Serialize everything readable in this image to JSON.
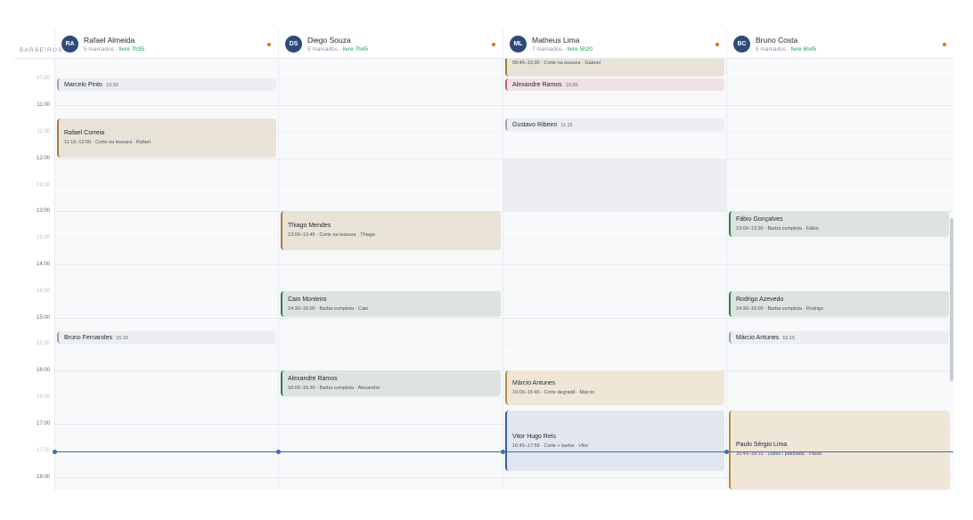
{
  "header": {
    "gutter_label": "BARBEIROS",
    "barbers": [
      {
        "initials": "RA",
        "name": "Rafael Almeida",
        "booked": "5 marcados",
        "sep": "·",
        "free": "livre 7h35"
      },
      {
        "initials": "DS",
        "name": "Diego Souza",
        "booked": "5 marcados",
        "sep": "·",
        "free": "livre 7h45"
      },
      {
        "initials": "ML",
        "name": "Matheus Lima",
        "booked": "7 marcados",
        "sep": "·",
        "free": "livre 5h20"
      },
      {
        "initials": "BC",
        "name": "Bruno Costa",
        "booked": "5 marcados",
        "sep": "·",
        "free": "livre 6h45"
      }
    ],
    "accent_dot_color": "#c77a23",
    "avatar_color": "#2f4a77"
  },
  "times": {
    "t1030": "10:30",
    "t1100": "11:00",
    "t1130": "11:30",
    "t1200": "12:00",
    "t1230": "12:30",
    "t1300": "13:00",
    "t1330": "13:30",
    "t1400": "14:00",
    "t1430": "14:30",
    "t1500": "15:00",
    "t1530": "15:30",
    "t1600": "16:00",
    "t1630": "16:30",
    "t1700": "17:00",
    "t1730": "17:30",
    "t1800": "18:00"
  },
  "events": {
    "ra_marcelo": {
      "title": "Marcelo Pinto",
      "time": "10:30"
    },
    "ra_rafael": {
      "title": "Rafael Correia",
      "detail": "11:15–12:00 · Corte na tesoura · Rafael"
    },
    "ra_bruno": {
      "title": "Bruno Fernandes",
      "time": "15:15"
    },
    "ds_thiago": {
      "title": "Thiago Mendes",
      "detail": "13:00–13:45 · Corte na tesoura · Thiago"
    },
    "ds_caio": {
      "title": "Caio Monteiro",
      "detail": "14:30–15:00 · Barba completa · Caio"
    },
    "ds_alexandre": {
      "title": "Alexandre Ramos",
      "detail": "16:00–16:30 · Barba completa · Alexandre"
    },
    "ml_gabriel": {
      "detail": "09:45–10:30 · Corte na tesoura · Gabriel"
    },
    "ml_alexandre": {
      "title": "Alexandre Ramos",
      "time": "10:30"
    },
    "ml_gustavo": {
      "title": "Gustavo Ribeiro",
      "time": "11:15"
    },
    "ml_marcio": {
      "title": "Márcio Antunes",
      "detail": "16:00–16:40 · Corte degradê · Márcio"
    },
    "ml_vitor": {
      "title": "Vitor Hugo Reis",
      "detail": "16:45–17:55 · Corte + barba · Vitor"
    },
    "bc_fabio": {
      "title": "Fábio Gonçalves",
      "detail": "13:00–13:30 · Barba completa · Fábio"
    },
    "bc_rodrigo": {
      "title": "Rodrigo Azevedo",
      "detail": "14:30–15:00 · Barba completa · Rodrigo"
    },
    "bc_marcio": {
      "title": "Márcio Antunes",
      "time": "15:15"
    },
    "bc_paulo": {
      "title": "Paulo Sérgio Lima",
      "detail": "16:45–18:15 · Luzes / platinado · Paulo"
    }
  },
  "colors": {
    "now_line": "#3d6fa8",
    "free_text": "#1f9a58"
  }
}
